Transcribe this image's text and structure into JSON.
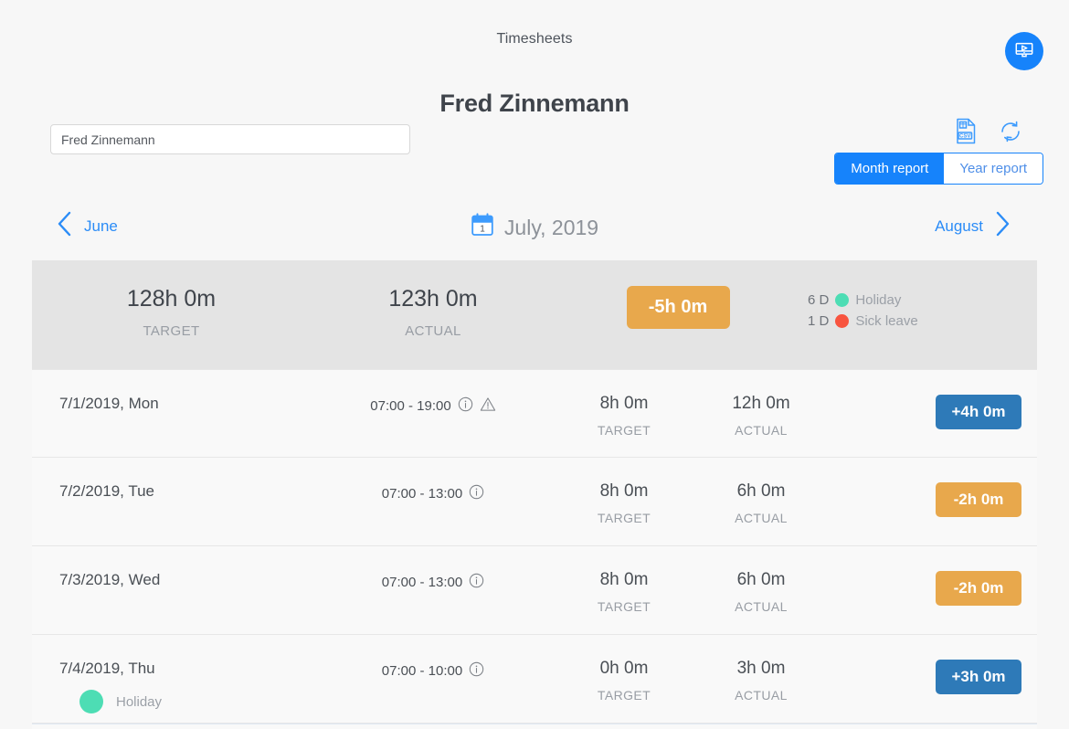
{
  "app": {
    "title": "Timesheets",
    "video_button_icon": "monitor-play-icon"
  },
  "employee": {
    "name": "Fred Zinnemann"
  },
  "search": {
    "value": "Fred Zinnemann",
    "placeholder": "Fred Zinnemann"
  },
  "toolbar": {
    "csv_icon": "csv-file-icon",
    "refresh_icon": "refresh-icon",
    "month_report_label": "Month report",
    "year_report_label": "Year report",
    "active_report": "Month report"
  },
  "month_nav": {
    "prev_label": "June",
    "prev_icon": "chevron-left-icon",
    "current_label": "July, 2019",
    "calendar_icon": "calendar-icon",
    "calendar_day": "1",
    "next_label": "August",
    "next_icon": "chevron-right-icon"
  },
  "summary": {
    "target_value": "128h 0m",
    "target_label": "TARGET",
    "actual_value": "123h 0m",
    "actual_label": "ACTUAL",
    "diff_value": "-5h 0m",
    "diff_color": "#e8a84c",
    "legend": [
      {
        "days": "6 D",
        "label": "Holiday",
        "color": "#4dddb4"
      },
      {
        "days": "1 D",
        "label": "Sick leave",
        "color": "#f8543f"
      }
    ]
  },
  "colors": {
    "accent_blue": "#1683fb",
    "badge_blue": "#2e7ab8",
    "badge_orange": "#e8a84c",
    "holiday_green": "#4dddb4",
    "sick_red": "#f8543f",
    "summary_bg": "#e4e4e4"
  },
  "table": {
    "labels": {
      "target": "TARGET",
      "actual": "ACTUAL"
    },
    "rows": [
      {
        "date": "7/1/2019, Mon",
        "time_range": "07:00 - 19:00",
        "icons": [
          "info-icon",
          "warning-icon"
        ],
        "target": "8h 0m",
        "actual": "12h 0m",
        "diff": "+4h 0m",
        "diff_color": "#2e7ab8",
        "tag": null
      },
      {
        "date": "7/2/2019, Tue",
        "time_range": "07:00 - 13:00",
        "icons": [
          "info-icon"
        ],
        "target": "8h 0m",
        "actual": "6h 0m",
        "diff": "-2h 0m",
        "diff_color": "#e8a84c",
        "tag": null
      },
      {
        "date": "7/3/2019, Wed",
        "time_range": "07:00 - 13:00",
        "icons": [
          "info-icon"
        ],
        "target": "8h 0m",
        "actual": "6h 0m",
        "diff": "-2h 0m",
        "diff_color": "#e8a84c",
        "tag": null
      },
      {
        "date": "7/4/2019, Thu",
        "time_range": "07:00 - 10:00",
        "icons": [
          "info-icon"
        ],
        "target": "0h 0m",
        "actual": "3h 0m",
        "diff": "+3h 0m",
        "diff_color": "#2e7ab8",
        "tag": {
          "label": "Holiday",
          "color": "#4dddb4"
        }
      }
    ]
  }
}
